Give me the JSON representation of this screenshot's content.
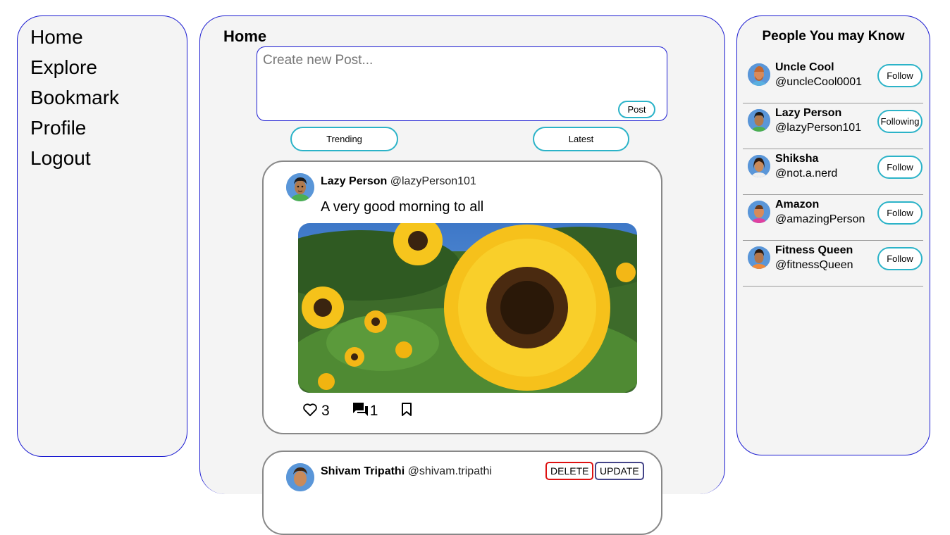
{
  "nav": [
    "Home",
    "Explore",
    "Bookmark",
    "Profile",
    "Logout"
  ],
  "main": {
    "title": "Home",
    "composer": {
      "placeholder": "Create new Post...",
      "value": "",
      "post_label": "Post"
    },
    "tabs": [
      "Trending",
      "Latest"
    ]
  },
  "posts": [
    {
      "name": "Lazy Person",
      "handle": "@lazyPerson101",
      "text": "A very good morning to all",
      "image": "sunflower-photo",
      "likes": "3",
      "comments": "1"
    },
    {
      "name": "Shivam Tripathi",
      "handle": "@shivam.tripathi",
      "delete_label": "DELETE",
      "update_label": "UPDATE"
    }
  ],
  "sidebar": {
    "title": "People You may Know",
    "people": [
      {
        "name": "Uncle Cool",
        "handle": "@uncleCool0001",
        "action": "Follow"
      },
      {
        "name": "Lazy Person",
        "handle": "@lazyPerson101",
        "action": "Following"
      },
      {
        "name": "Shiksha",
        "handle": "@not.a.nerd",
        "action": "Follow"
      },
      {
        "name": "Amazon",
        "handle": "@amazingPerson",
        "action": "Follow"
      },
      {
        "name": "Fitness Queen",
        "handle": "@fitnessQueen",
        "action": "Follow"
      }
    ]
  },
  "colors": {
    "panel_border": "#1a1ad1",
    "accent": "#2bb3c8",
    "delete": "#dd1111",
    "panel_bg": "#f4f4f4"
  },
  "icons": {
    "like": "heart-outline-icon",
    "comment": "chat-bubbles-icon",
    "bookmark": "bookmark-outline-icon"
  }
}
